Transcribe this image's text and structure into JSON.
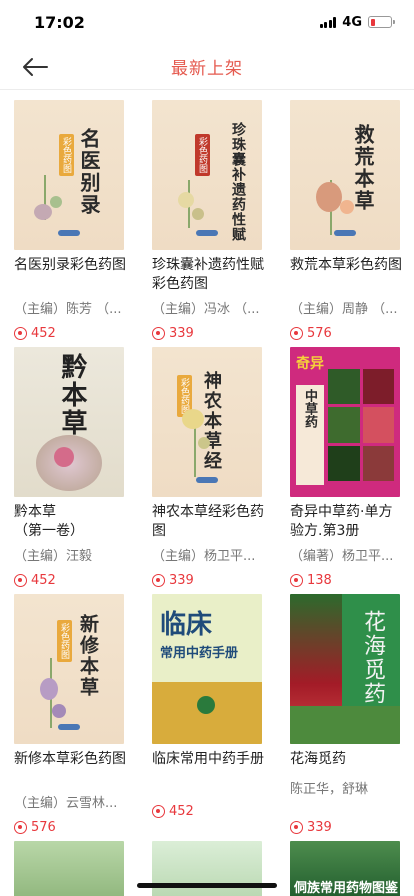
{
  "status": {
    "time": "17:02",
    "network": "4G"
  },
  "nav": {
    "title": "最新上架"
  },
  "books": [
    {
      "title": "名医别录彩色药图",
      "author": "（主编）陈芳 （...",
      "price": "452",
      "cover_text": "名医别录",
      "cover_tag": "彩色药图"
    },
    {
      "title": "珍珠囊补遗药性赋彩色药图",
      "author": "（主编）冯冰 （...",
      "price": "339",
      "cover_text": "珍珠囊补遗药性赋",
      "cover_tag": "彩色药图"
    },
    {
      "title": "救荒本草彩色药图",
      "author": "（主编）周静 （...",
      "price": "576",
      "cover_text": "救荒本草",
      "cover_tag": ""
    },
    {
      "title": "黔本草\n（第一卷）",
      "author": "（主编）汪毅",
      "price": "452",
      "cover_text": "黔本草",
      "cover_tag": ""
    },
    {
      "title": "神农本草经彩色药图",
      "author": "（主编）杨卫平...",
      "price": "339",
      "cover_text": "神农本草经",
      "cover_tag": "彩色药图"
    },
    {
      "title": "奇异中草药·单方验方.第3册",
      "author": "（编著）杨卫平...",
      "price": "138",
      "cover_text": "中草药",
      "cover_tag": "奇异"
    },
    {
      "title": "新修本草彩色药图",
      "author": "（主编）云雪林...",
      "price": "576",
      "cover_text": "新修本草",
      "cover_tag": "彩色药图"
    },
    {
      "title": "临床常用中药手册",
      "author": "",
      "price": "452",
      "cover_text": "临床",
      "cover_sub": "常用中药手册"
    },
    {
      "title": "花海觅药",
      "author": "陈正华，舒琳",
      "price": "339",
      "cover_text": "花海觅药",
      "cover_tag": ""
    }
  ],
  "partial_covers": [
    "",
    "",
    "侗族常用药物图鉴"
  ]
}
